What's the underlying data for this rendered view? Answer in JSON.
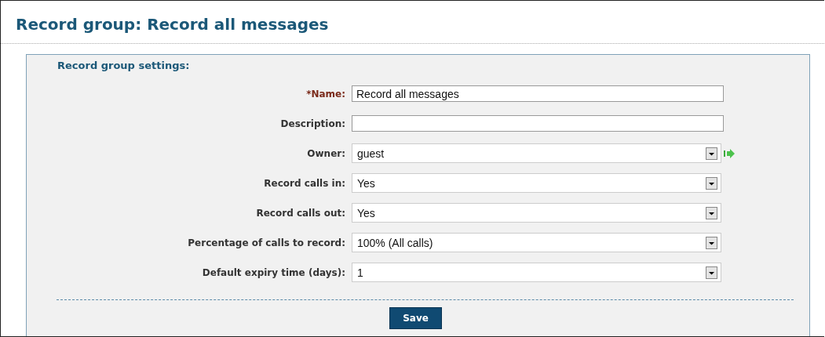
{
  "title": "Record group: Record all messages",
  "section_title": "Record group settings:",
  "fields": [
    {
      "label": "*Name:",
      "kind": "text",
      "required": true,
      "value": "Record all messages"
    },
    {
      "label": "Description:",
      "kind": "text",
      "required": false
    },
    {
      "label": "Owner:",
      "kind": "select",
      "required": false,
      "value": "guest",
      "link": true
    },
    {
      "label": "Record calls in:",
      "kind": "select",
      "required": false,
      "value": "Yes"
    },
    {
      "label": "Record calls out:",
      "kind": "select",
      "required": false,
      "value": "Yes"
    },
    {
      "label": "Percentage of calls to record:",
      "kind": "select",
      "required": false,
      "value": "100% (All calls)"
    },
    {
      "label": "Default expiry time (days):",
      "kind": "select",
      "required": false,
      "value": "1"
    }
  ],
  "save_button": "Save"
}
